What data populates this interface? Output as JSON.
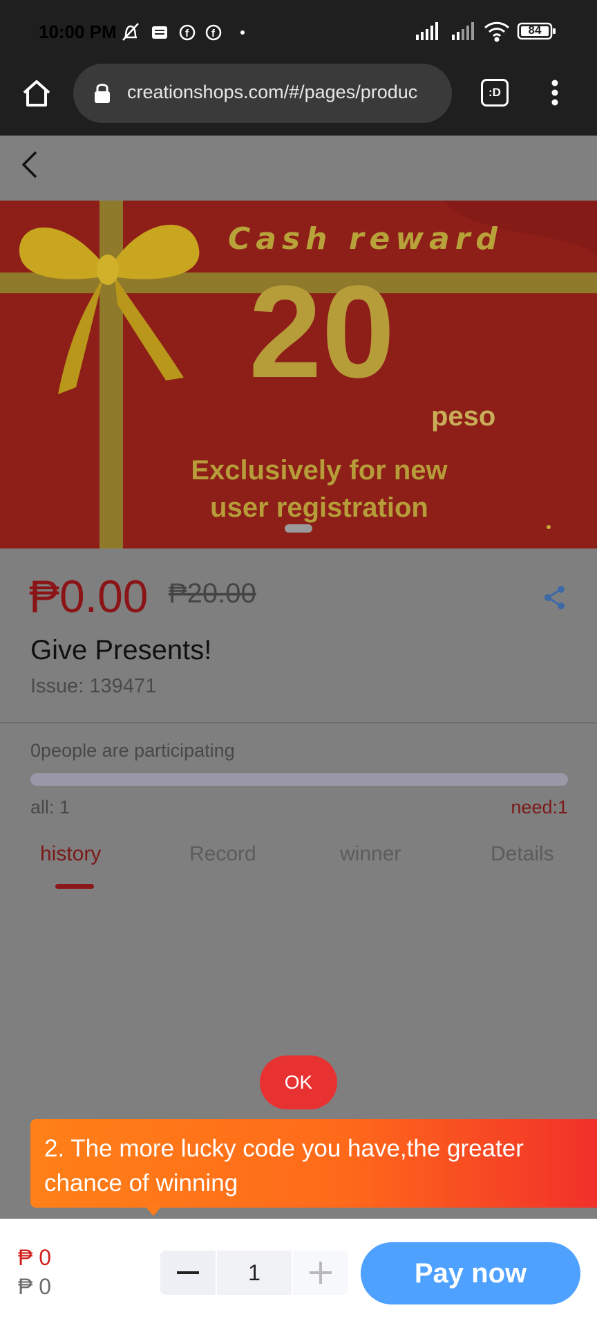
{
  "status_bar": {
    "time": "10:00 PM",
    "battery": "84"
  },
  "browser": {
    "url": "creationshops.com/#/pages/produc",
    "tab_switch_label": ":D"
  },
  "banner": {
    "heading": "Cash reward",
    "amount": "20",
    "unit": "peso",
    "line1": "Exclusively for new",
    "line2": "user registration"
  },
  "product": {
    "price": "₱0.00",
    "original_price": "₱20.00",
    "title": "Give Presents!",
    "issue": "Issue: 139471"
  },
  "participation": {
    "text": "0people are participating",
    "all": "all: 1",
    "need": "need:1",
    "progress": 0
  },
  "tabs": [
    {
      "label": "history",
      "active": true
    },
    {
      "label": "Record",
      "active": false
    },
    {
      "label": "winner",
      "active": false
    },
    {
      "label": "Details",
      "active": false
    }
  ],
  "overlay": {
    "ok_label": "OK",
    "tooltip": "2. The more lucky code you have,the greater chance of winning"
  },
  "footer": {
    "price_red": "₱ 0",
    "price_grey": "₱ 0",
    "quantity": "1",
    "pay_label": "Pay now"
  },
  "colors": {
    "accent_red": "#8c1719",
    "ok_red": "#e83232",
    "tooltip_orange": "#ff8018",
    "pay_blue": "#4ea1ff"
  }
}
